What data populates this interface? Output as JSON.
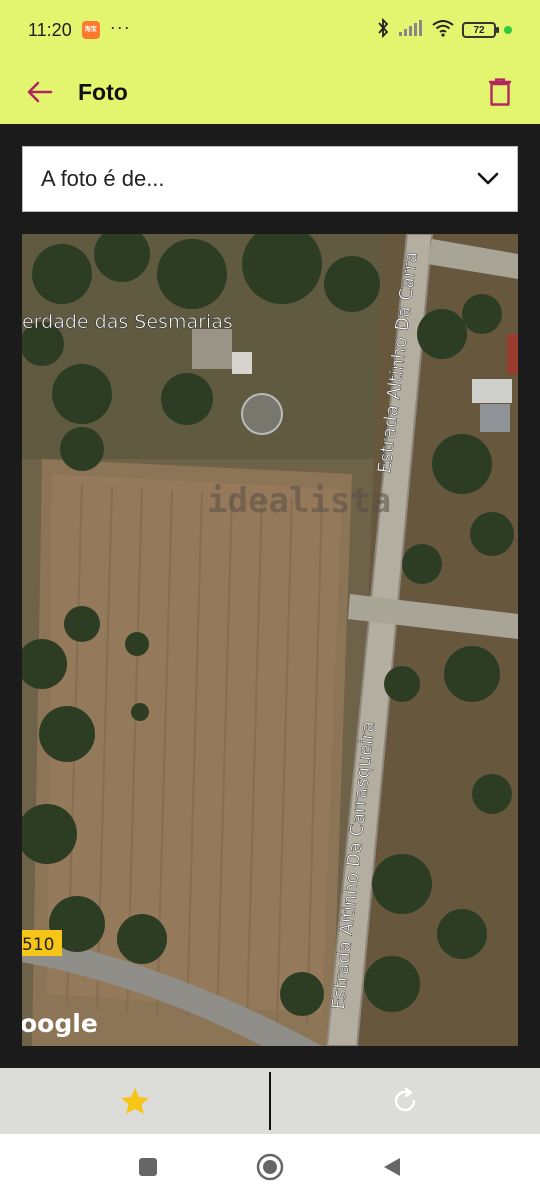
{
  "status_bar": {
    "time": "11:20",
    "notification_icon": "app-notification-icon",
    "notification_text": "淘宝",
    "more_label": "···",
    "battery_level": "72",
    "icons": [
      "bluetooth-icon",
      "signal-icon",
      "wifi-icon",
      "battery-icon"
    ]
  },
  "app_bar": {
    "title": "Foto",
    "back_icon": "arrow-back-icon",
    "delete_icon": "trash-icon"
  },
  "dropdown": {
    "selected_text": "A foto é de...",
    "icon": "chevron-down-icon"
  },
  "photo": {
    "labels": {
      "place_name": "erdade das Sesmarias",
      "road_top": "Estrada Altinho Da Carra",
      "road_bottom": "Estrada Altinho Da Carrasqueira",
      "road_number": "510",
      "watermark": "idealista",
      "google": "oogle"
    }
  },
  "bottom_bar": {
    "favorite_icon": "star-icon",
    "rotate_icon": "rotate-icon"
  },
  "colors": {
    "accent": "#e3f56e",
    "primary": "#b0285f",
    "star": "#f5c518"
  }
}
